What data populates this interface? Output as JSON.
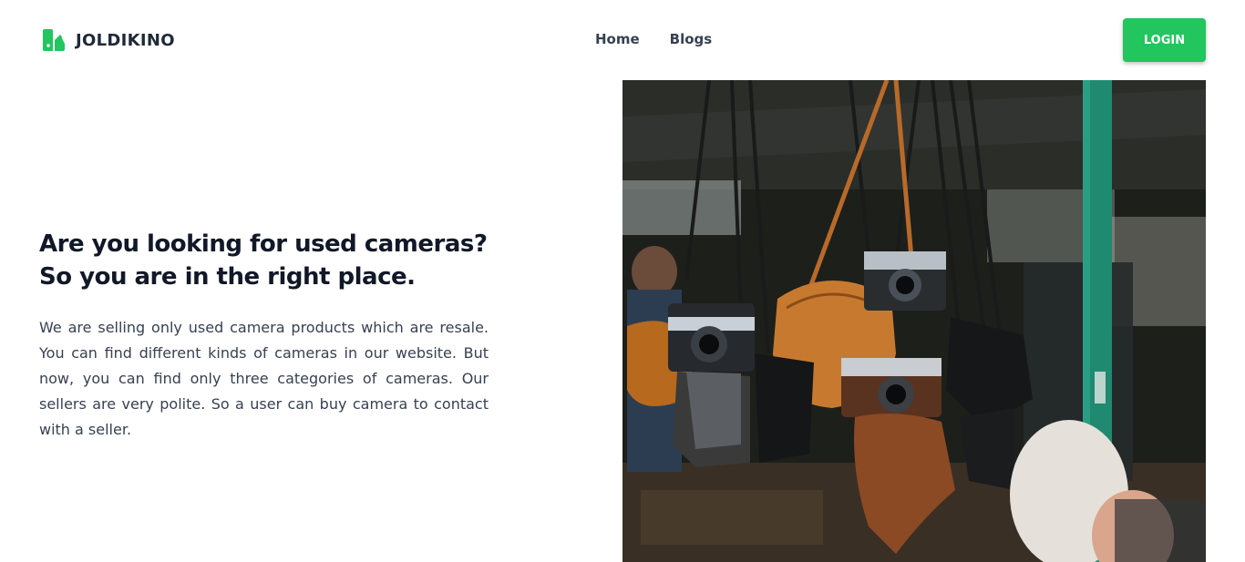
{
  "brand": {
    "name": "JOLDIKINO",
    "logo_icon": "leaf-logo-icon",
    "accent_color": "#22c55e"
  },
  "nav": {
    "items": [
      {
        "label": "Home"
      },
      {
        "label": "Blogs"
      }
    ]
  },
  "header": {
    "login_label": "LOGIN"
  },
  "hero": {
    "title_line1": "Are you looking for used cameras?",
    "title_line2": "So you are in the right place.",
    "description": "We are selling only used camera products which are resale. You can find different kinds of cameras in our website. But now, you can find only three categories of cameras. Our sellers are very polite. So a user can buy camera to contact with a seller.",
    "image_subject": "vintage cameras hanging at a flea market"
  }
}
